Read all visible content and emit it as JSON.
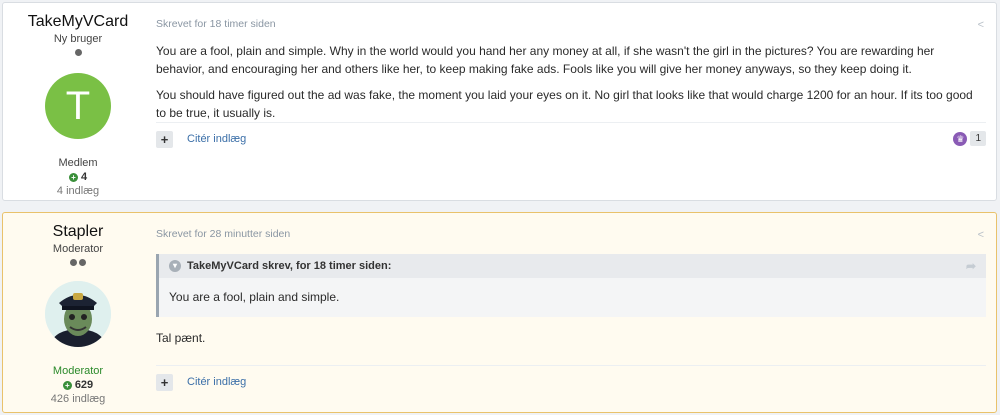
{
  "posts": [
    {
      "author": {
        "name": "TakeMyVCard",
        "title": "Ny bruger",
        "avatar_letter": "T",
        "group": "Medlem",
        "reputation": "4",
        "posts": "4 indlæg"
      },
      "meta": "Skrevet for 18 timer siden",
      "paragraphs": [
        "You are a fool, plain and simple. Why in the world would you hand her any money at all, if she wasn't the girl in the pictures? You are rewarding her behavior, and encouraging her and others like her, to keep making fake ads. Fools like you will give her money anyways, so they keep doing it.",
        "You should have figured out the ad was fake, the moment you laid your eyes on it. No girl that looks like that would charge 1200 for an hour. If its too good to be true, it usually is."
      ],
      "actions": {
        "quote_label": "Citér indlæg",
        "reaction_count": "1"
      }
    },
    {
      "author": {
        "name": "Stapler",
        "title": "Moderator",
        "group": "Moderator",
        "reputation": "629",
        "posts": "426 indlæg"
      },
      "meta": "Skrevet for 28 minutter siden",
      "quote": {
        "header": "TakeMyVCard skrev, for 18 timer siden:",
        "body": "You are a fool, plain and simple."
      },
      "paragraphs": [
        "Tal pænt."
      ],
      "actions": {
        "quote_label": "Citér indlæg"
      }
    }
  ],
  "colors": {
    "avatar_green": "#7ac045",
    "moderator_border": "#e9c26b",
    "link": "#3b6fa8"
  },
  "icons": [
    "share-icon",
    "plus-icon",
    "reputation-plus-icon",
    "reaction-trophy-icon",
    "chevron-down-icon",
    "quote-jump-icon"
  ]
}
